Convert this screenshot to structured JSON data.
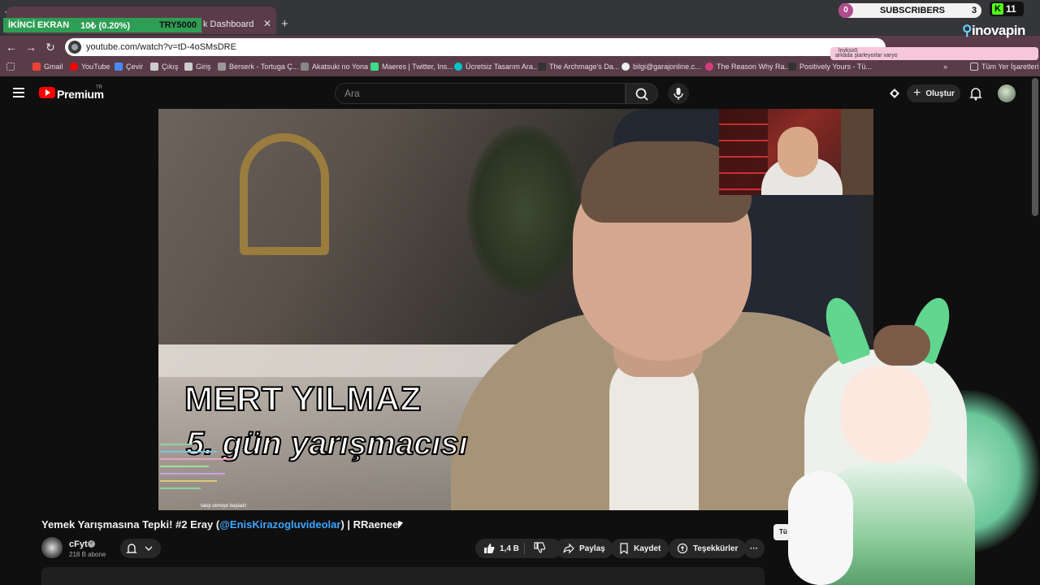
{
  "overlay": {
    "screen_label": "İKİNCİ EKRAN",
    "goal_progress": "10₺ (0.20%)",
    "goal_target": "TRY5000",
    "subscribers_label": "SUBSCRIBERS",
    "subscribers_left": "0",
    "subscribers_right": "3",
    "kick_count": "11",
    "sponsor_prefix": "ino",
    "sponsor_suffix": "vapin",
    "chat_toast_user": "lnyksx0",
    "chat_toast_msg": "arkada şlarleyorlar varyo"
  },
  "browser": {
    "tab_title": "k Dashboard",
    "url": "youtube.com/watch?v=tD-4oSMsDRE",
    "bookmarks": [
      "Gmail",
      "YouTube",
      "Çevir",
      "Çıkış",
      "Giriş",
      "Berserk - Tortuga Ç...",
      "Akatsuki no Yona",
      "Maeres | Twitter, Ins...",
      "Ücretsiz Tasarım Ara...",
      "The Archmage's Da...",
      "bilgi@garajonline.c...",
      "The Reason Why Ra...",
      "Positively Yours - Tü..."
    ],
    "all_bookmarks": "Tüm Yer İşaretleri",
    "colors": {
      "chrome": "#5a3c49",
      "omnibox": "#ffffff"
    }
  },
  "youtube": {
    "brand": "Premium",
    "country": "TR",
    "search_placeholder": "Ara",
    "create_label": "Oluştur"
  },
  "video": {
    "caption_name": "MERT YILMAZ",
    "caption_sub": "5. gün yarışmacısı",
    "follow_toast": "takip etmeye başladı!",
    "title_prefix": "Yemek Yarışmasına Tepki! #2 Eray (",
    "title_mention": "@EnisKirazogluvideolar",
    "title_suffix": ") | RRaenee",
    "channel_name": "cFyt",
    "subscriber_count": "218 B abone",
    "like_count": "1,4 B",
    "share_label": "Paylaş",
    "save_label": "Kaydet",
    "thanks_label": "Teşekkürler",
    "more_label": "···",
    "partial_label": "Tü"
  }
}
